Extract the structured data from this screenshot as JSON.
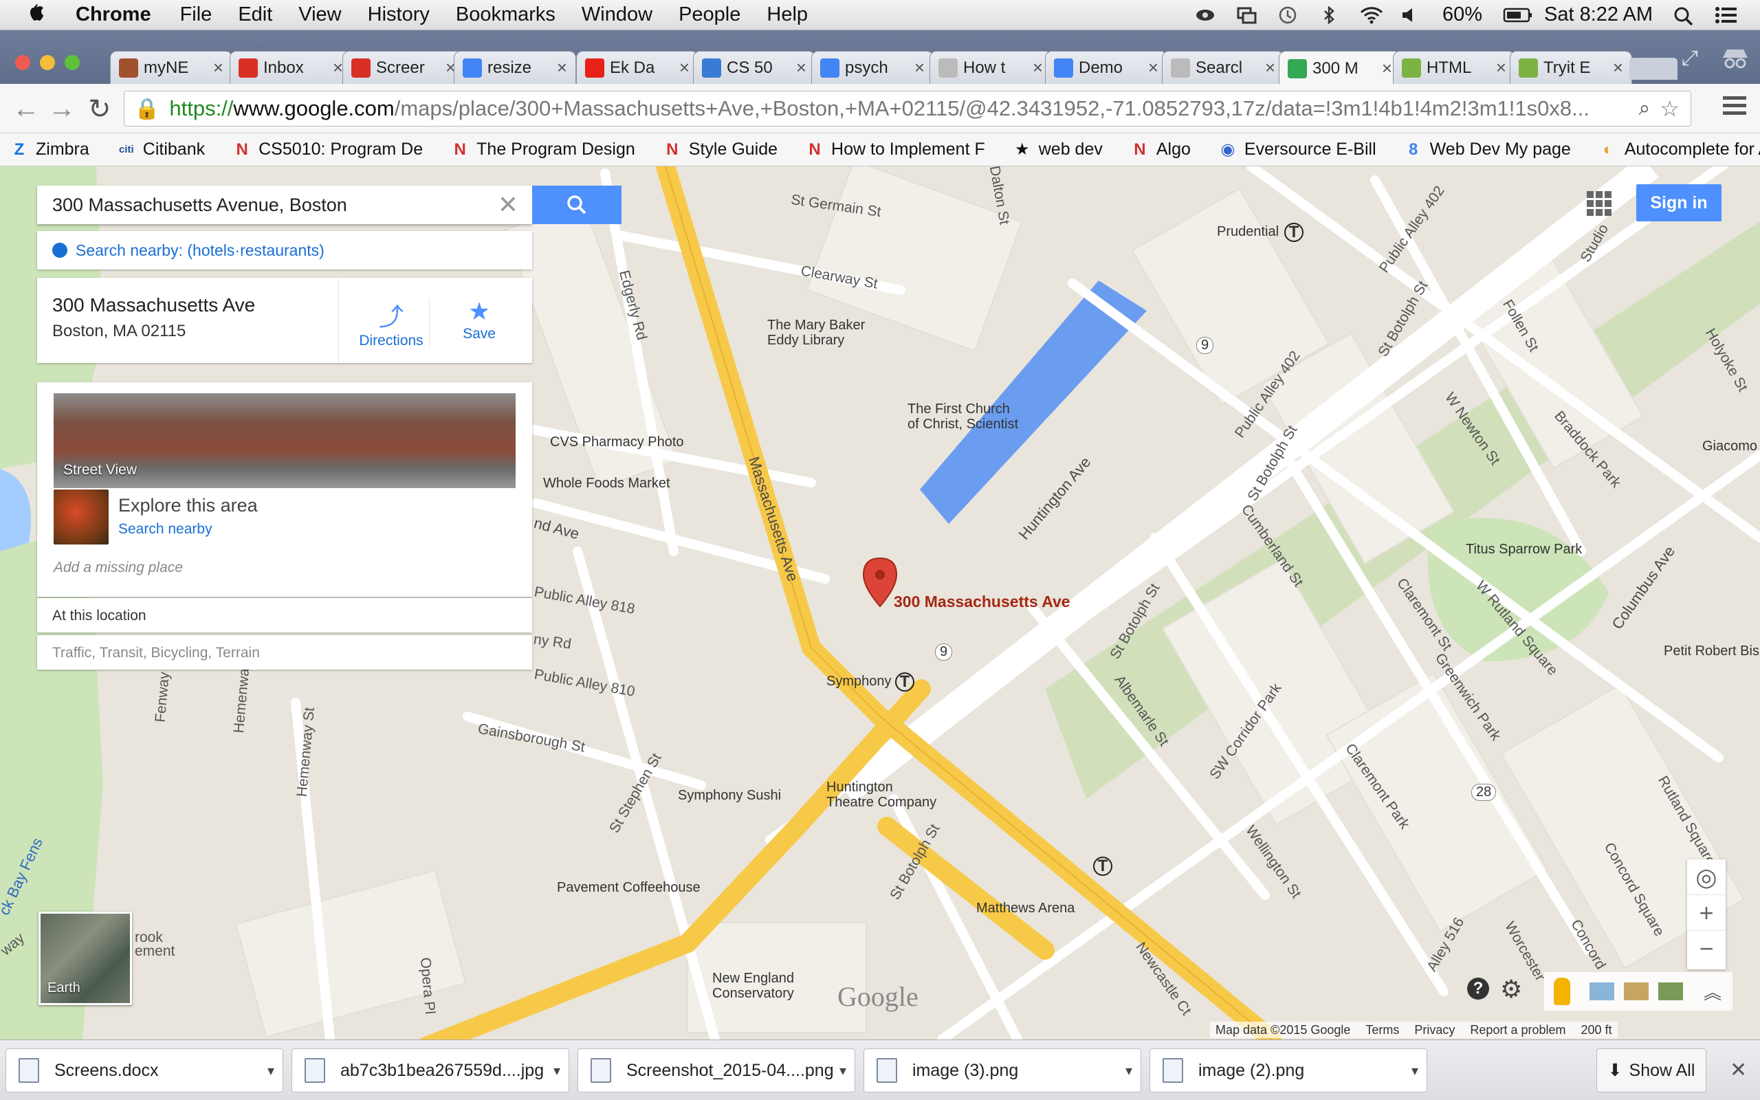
{
  "menubar": {
    "app": "Chrome",
    "items": [
      "File",
      "Edit",
      "View",
      "History",
      "Bookmarks",
      "Window",
      "People",
      "Help"
    ],
    "battery": "60%",
    "clock": "Sat 8:22 AM"
  },
  "tabs": [
    {
      "label": "myNE",
      "color": "#a0522d"
    },
    {
      "label": "Inbox",
      "color": "#d93025"
    },
    {
      "label": "Screer",
      "color": "#d93025"
    },
    {
      "label": "resize",
      "color": "#4285f4"
    },
    {
      "label": "Ek Da",
      "color": "#e62117"
    },
    {
      "label": "CS 50",
      "color": "#3a7bd5"
    },
    {
      "label": "psych",
      "color": "#4285f4"
    },
    {
      "label": "How t",
      "color": "#bbbbbb"
    },
    {
      "label": "Demo",
      "color": "#4285f4"
    },
    {
      "label": "Searcl",
      "color": "#bbbbbb"
    },
    {
      "label": "300 M",
      "color": "#34a853"
    },
    {
      "label": "HTML",
      "color": "#7cb342"
    },
    {
      "label": "Tryit E",
      "color": "#7cb342"
    }
  ],
  "omnibox": {
    "https": "https://",
    "domain": "www.google.com",
    "path": "/maps/place/300+Massachusetts+Ave,+Boston,+MA+02115/@42.3431952,-71.0852793,17z/data=!3m1!4b1!4m2!3m1!1s0x8..."
  },
  "bookmarks": [
    {
      "label": "Zimbra",
      "icon": "Z"
    },
    {
      "label": "Citibank",
      "icon": "citi"
    },
    {
      "label": "CS5010: Program De",
      "icon": "N"
    },
    {
      "label": "The Program Design",
      "icon": "N"
    },
    {
      "label": "Style Guide",
      "icon": "N"
    },
    {
      "label": "How to Implement F",
      "icon": "N"
    },
    {
      "label": "web dev",
      "icon": "★"
    },
    {
      "label": "Algo",
      "icon": "N"
    },
    {
      "label": "Eversource E-Bill",
      "icon": "◉"
    },
    {
      "label": "Web Dev My page",
      "icon": "8"
    },
    {
      "label": "Autocomplete for Ad",
      "icon": "◐"
    }
  ],
  "search": {
    "value": "300 Massachusetts Avenue, Boston",
    "nearby_prefix": "Search nearby: (",
    "nearby_links": "hotels·restaurants",
    "nearby_suffix": ")"
  },
  "place": {
    "name": "300 Massachusetts Ave",
    "address": "Boston, MA 02115",
    "directions": "Directions",
    "save": "Save",
    "street_view": "Street View",
    "explore_title": "Explore this area",
    "explore_link": "Search nearby",
    "add_place": "Add a missing place",
    "at_location": "At this location",
    "layers": "Traffic, Transit, Bicycling, Terrain"
  },
  "map": {
    "marker_label": "300 Massachusetts Ave",
    "sign_in": "Sign in",
    "earth": "Earth",
    "logo": "Google",
    "attribution": [
      "Map data ©2015 Google",
      "Terms",
      "Privacy",
      "Report a problem",
      "200 ft"
    ],
    "labels": {
      "st_germain": "St Germain St",
      "clearway": "Clearway St",
      "dalton": "Dalton St",
      "prudential": "Prudential",
      "mary_baker": "The Mary Baker",
      "eddy": "Eddy Library",
      "first_church": "The First Church",
      "christ_scientist": "of Christ, Scientist",
      "cvs": "CVS Pharmacy Photo",
      "whole_foods": "Whole Foods Market",
      "mass_ave": "Massachusetts Ave",
      "huntington": "Huntington Ave",
      "edgerly": "Edgerly Rd",
      "public_alley_402": "Public Alley 402",
      "public_alley_402b": "Public Alley 402",
      "st_botolph": "St Botolph St",
      "st_botolph2": "St Botolph St",
      "st_botolph3": "St Botolph St",
      "st_botolph4": "St Botolph St",
      "cumberland": "Cumberland St",
      "follen": "Follen St",
      "holyoke": "Holyoke St",
      "w_newton": "W Newton St",
      "braddock": "Braddock Park",
      "titus": "Titus Sparrow Park",
      "claremont": "Claremont St",
      "w_rutland": "W Rutland Square",
      "columbus": "Columbus Ave",
      "petit_robert": "Petit Robert Bis",
      "greenwich": "Greenwich Park",
      "sw_corridor": "SW Corridor Park",
      "albemarle": "Albemarle St",
      "claremont_park": "Claremont Park",
      "rutland_sq": "Rutland Square",
      "concord_sq": "Concord Square",
      "wellington": "Wellington St",
      "alley_516": "Alley 516",
      "worcester": "Worcester",
      "concord": "Concord",
      "symphony": "Symphony",
      "symphony_sushi": "Symphony Sushi",
      "huntington_theatre1": "Huntington",
      "huntington_theatre2": "Theatre Company",
      "pavement": "Pavement Coffeehouse",
      "matthews": "Matthews Arena",
      "nec1": "New England",
      "nec2": "Conservatory",
      "gainsborough": "Gainsborough St",
      "st_stephen": "St Stephen St",
      "hemenway": "Hemenway St",
      "hemenway2": "Hemenway",
      "fenway": "Fenway",
      "opera": "Opera Pl",
      "newcastle": "Newcastle Ct",
      "public_alley_818": "Public Alley 818",
      "public_alley_810": "Public Alley 810",
      "ny_rd": "ny Rd",
      "nd_ave": "nd Ave",
      "back_bay_fens": "ck Bay Fens",
      "giacomo": "Giacomo",
      "rook": "rook",
      "ement": "ement",
      "way": "way",
      "studio": "Studio",
      "public_alley_402_top": "Public Alley 402",
      "route_9": "9",
      "route_28": "28",
      "st_left": "St"
    }
  },
  "downloads": [
    {
      "label": "Screens.docx"
    },
    {
      "label": "ab7c3b1bea267559d....jpg"
    },
    {
      "label": "Screenshot_2015-04....png"
    },
    {
      "label": "image (3).png"
    },
    {
      "label": "image (2).png"
    }
  ],
  "show_all": "Show All"
}
